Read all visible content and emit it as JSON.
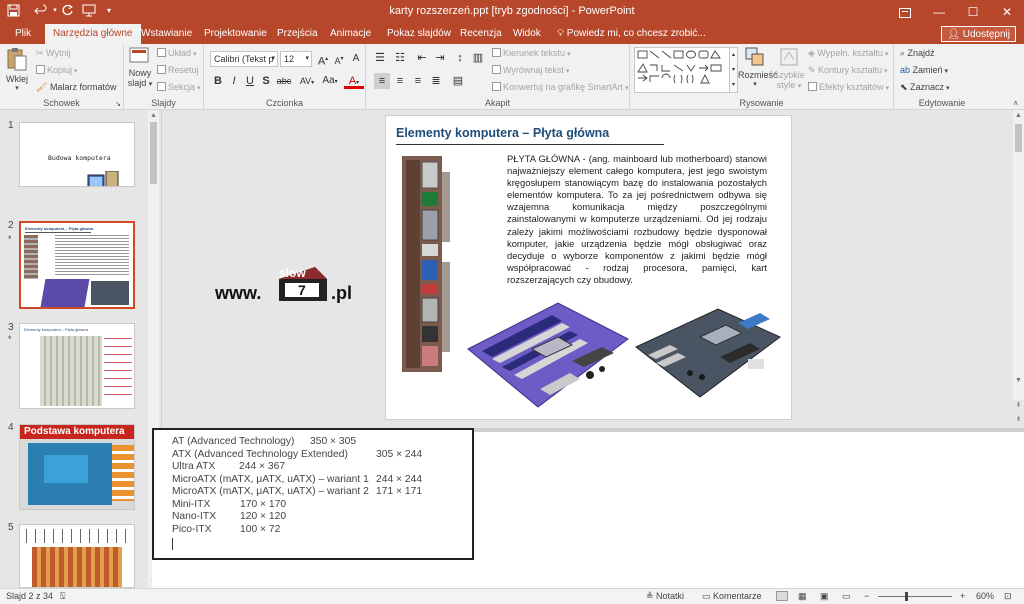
{
  "window": {
    "title": "karty rozszerzeń.ppt [tryb zgodności] - PowerPoint",
    "accent": "#b7472a"
  },
  "quick_access": {
    "save_icon": "save-icon",
    "undo_icon": "undo-icon",
    "redo_icon": "redo-icon",
    "present_icon": "present-icon",
    "more_icon": "chevron-down-icon"
  },
  "ribbon_tabs": [
    {
      "label": "Plik"
    },
    {
      "label": "Narzędzia główne",
      "active": true
    },
    {
      "label": "Wstawianie"
    },
    {
      "label": "Projektowanie"
    },
    {
      "label": "Przejścia"
    },
    {
      "label": "Animacje"
    },
    {
      "label": "Pokaz slajdów"
    },
    {
      "label": "Recenzja"
    },
    {
      "label": "Widok"
    }
  ],
  "tell_me": "Powiedz mi, co chcesz zrobić...",
  "share_label": "Udostępnij",
  "ribbon": {
    "clipboard": {
      "label": "Schowek",
      "paste": "Wklej",
      "cut": "Wytnij",
      "copy": "Kopiuj",
      "format_painter": "Malarz formatów"
    },
    "slides": {
      "label": "Slajdy",
      "new_slide_1": "Nowy",
      "new_slide_2": "slajd",
      "layout": "Układ",
      "reset": "Resetuj",
      "section": "Sekcja"
    },
    "font": {
      "label": "Czcionka",
      "family": "Calibri (Tekst p",
      "size": "12",
      "bold": "B",
      "italic": "I",
      "underline": "U",
      "shadow": "S",
      "strike": "abc",
      "spacing": "AV",
      "case": "Aa",
      "grow": "A",
      "shrink": "A",
      "clear": "A",
      "color": "A"
    },
    "paragraph": {
      "label": "Akapit",
      "text_direction": "Kierunek tekstu",
      "align_text": "Wyrównaj tekst",
      "smartart": "Konwertuj na grafikę SmartArt"
    },
    "drawing": {
      "label": "Rysowanie",
      "arrange_1": "Rozmieść",
      "quick_styles_1": "Szybkie",
      "quick_styles_2": "style",
      "shape_fill": "Wypełn. kształtu",
      "shape_outline": "Kontury kształtu",
      "shape_effects": "Efekty kształtów"
    },
    "editing": {
      "label": "Edytowanie",
      "find": "Znajdź",
      "replace": "Zamień",
      "select": "Zaznacz"
    }
  },
  "slide_thumbnails": [
    {
      "number": "1",
      "title": "Budowa komputera"
    },
    {
      "number": "2",
      "title": "Elementy komputera – Płyta główna",
      "selected": true,
      "star": "*"
    },
    {
      "number": "3",
      "title": "Elementy komputera – Płyta główna",
      "star": "*"
    },
    {
      "number": "4",
      "title": "Podstawa komputera"
    },
    {
      "number": "5",
      "title": ""
    }
  ],
  "slide": {
    "title": "Elementy komputera – Płyta główna",
    "body": "PŁYTA GŁÓWNA - (ang. mainboard lub motherboard) stanowi najważniejszy element całego komputera, jest jego swoistym kręgosłupem stanowiącym bazę do instalowania pozostałych elementów komputera. To za jej pośrednictwem odbywa się wzajemna komunikacja między poszczególnymi zainstalowanymi w komputerze urządzeniami. Od jej rodzaju zależy jakimi możliwościami rozbudowy będzie dysponował komputer, jakie urządzenia będzie mógł obsługiwać oraz decyduje o wyborze komponentów z jakimi będzie mógł współpracować - rodzaj procesora, pamięci, kart rozszerzających czy obudowy."
  },
  "watermark": {
    "prefix": "www.",
    "top": "slow",
    "mid": "7",
    "suffix": ".pl"
  },
  "notes": [
    {
      "name": "AT (Advanced Technology)",
      "size": "350 × 305"
    },
    {
      "name": "ATX (Advanced Technology Extended)",
      "size": "305 × 244"
    },
    {
      "name": "Ultra ATX",
      "size": "244 × 367"
    },
    {
      "name": "MicroATX (mATX, μATX, uATX) – wariant 1",
      "size": "244 × 244"
    },
    {
      "name": "MicroATX (mATX, μATX, uATX) – wariant 2",
      "size": "171 × 171"
    },
    {
      "name": "Mini-ITX",
      "size": "170 × 170"
    },
    {
      "name": "Nano-ITX",
      "size": "120 × 120"
    },
    {
      "name": "Pico-ITX",
      "size": "100 × 72"
    }
  ],
  "status": {
    "slide_counter": "Slajd 2 z 34",
    "notes": "Notatki",
    "comments": "Komentarze",
    "zoom": "60%"
  }
}
